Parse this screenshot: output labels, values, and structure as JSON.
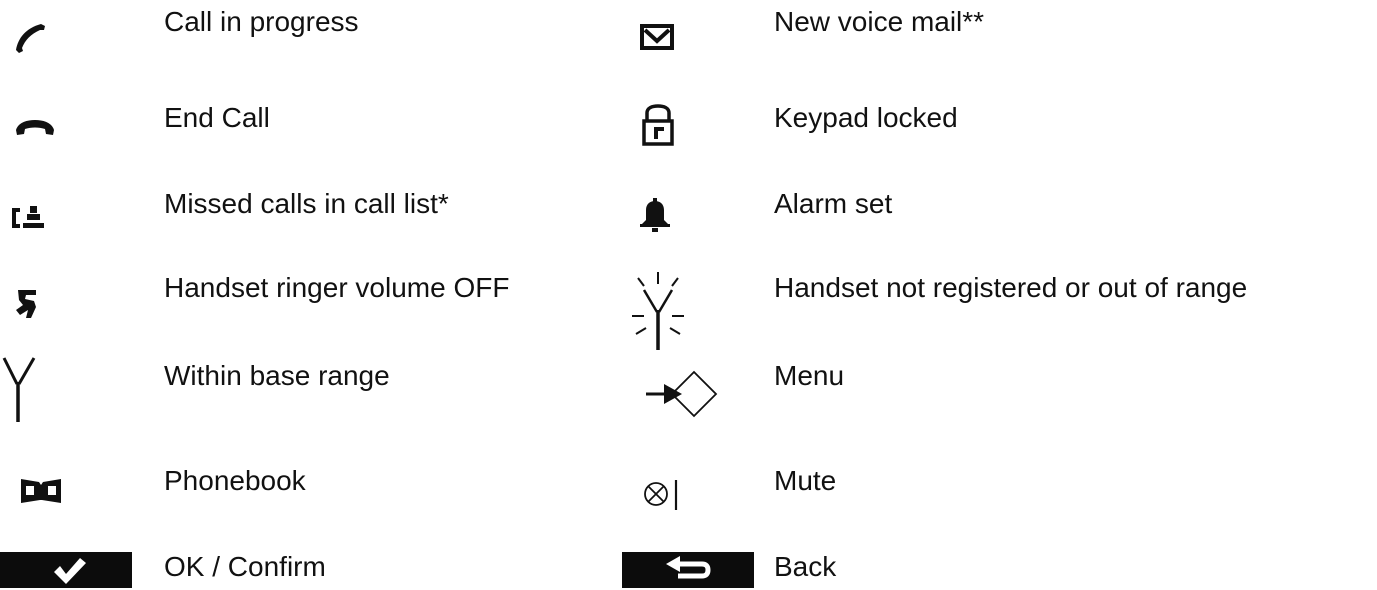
{
  "legend": {
    "left": [
      {
        "icon": "handset-in-call-icon",
        "label": "Call in progress"
      },
      {
        "icon": "handset-hang-up-icon",
        "label": "End Call"
      },
      {
        "icon": "missed-call-list-icon",
        "label": "Missed calls in call list*"
      },
      {
        "icon": "ringer-off-icon",
        "label": "Handset ringer volume OFF"
      },
      {
        "icon": "antenna-icon",
        "label": "Within base range"
      },
      {
        "icon": "phonebook-icon",
        "label": "Phonebook"
      },
      {
        "icon": "checkmark-softkey-icon",
        "label": "OK / Confirm"
      }
    ],
    "right": [
      {
        "icon": "voicemail-envelope-icon",
        "label": "New voice mail**"
      },
      {
        "icon": "keypad-lock-icon",
        "label": "Keypad locked"
      },
      {
        "icon": "alarm-bell-icon",
        "label": "Alarm set"
      },
      {
        "icon": "antenna-flashing-icon",
        "label": "Handset not registered or out of range"
      },
      {
        "icon": "menu-arrow-icon",
        "label": "Menu"
      },
      {
        "icon": "mute-icon",
        "label": "Mute"
      },
      {
        "icon": "back-arrow-softkey-icon",
        "label": "Back"
      }
    ]
  }
}
